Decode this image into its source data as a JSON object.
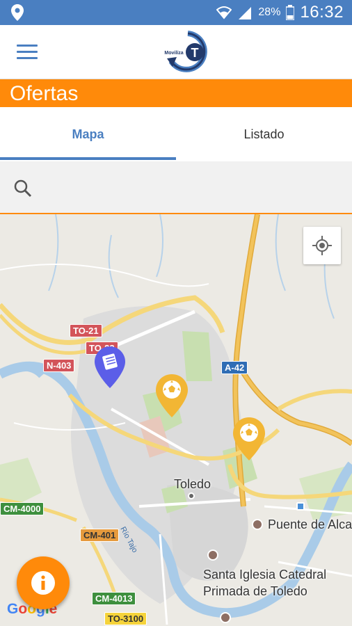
{
  "status_bar": {
    "battery": "28%",
    "time": "16:32",
    "icons": [
      "location-icon",
      "wifi-icon",
      "signal-icon",
      "battery-icon"
    ]
  },
  "app_bar": {
    "logo_text": "Movilíza",
    "logo_letter": "T",
    "menu_icon": "hamburger-menu-icon"
  },
  "section": {
    "title": "Ofertas",
    "color": "#ff8a0a"
  },
  "tabs": [
    {
      "label": "Mapa",
      "active": true
    },
    {
      "label": "Listado",
      "active": false
    }
  ],
  "search": {
    "value": "",
    "placeholder": ""
  },
  "map": {
    "road_labels": [
      "TO-21",
      "TO-22",
      "N-403",
      "A-42",
      "CM-4000",
      "CM-401",
      "CM-4013",
      "TO-3100"
    ],
    "river_label": "Río Tajo",
    "place_labels": {
      "toledo": "Toledo",
      "puente": "Puente de Alca",
      "catedral_line1": "Santa Iglesia Catedral",
      "catedral_line2": "Primada de Toledo"
    },
    "attribution": "Google",
    "markers": [
      {
        "type": "book",
        "color": "#5b5ee8"
      },
      {
        "type": "soccer",
        "color": "#f2b634"
      },
      {
        "type": "soccer",
        "color": "#f2b634"
      }
    ]
  },
  "fab": {
    "icon": "info-icon",
    "color": "#ff8a0a"
  },
  "colors": {
    "primary": "#4a7fc1",
    "accent": "#ff8a0a"
  }
}
